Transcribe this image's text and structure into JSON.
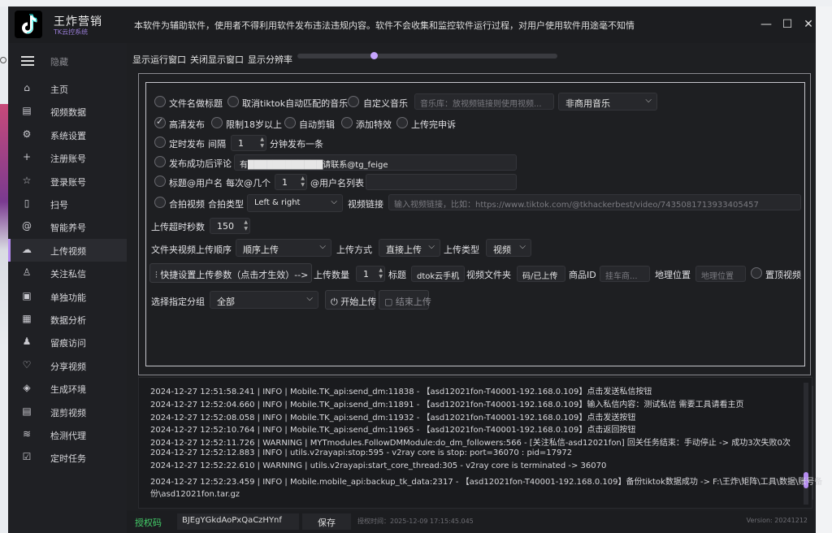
{
  "app": {
    "name": "王炸营销",
    "subtitle": "TK云控系统",
    "notice": "本软件为辅助软件，使用者不得利用软件发布违法违规内容。软件不会收集和监控软件运行过程，对用户使用软件用途毫不知情"
  },
  "window": {
    "minimize": "—",
    "maximize": "☐",
    "close": "✕"
  },
  "sidebar": {
    "hide_label": "隐藏",
    "items": [
      {
        "label": "主页",
        "icon": "home-icon",
        "glyph": "⌂"
      },
      {
        "label": "视频数据",
        "icon": "film-icon",
        "glyph": "▤"
      },
      {
        "label": "系统设置",
        "icon": "gear-icon",
        "glyph": "⚙"
      },
      {
        "label": "注册账号",
        "icon": "plus-icon",
        "glyph": "+"
      },
      {
        "label": "登录账号",
        "icon": "star-icon",
        "glyph": "☆"
      },
      {
        "label": "扫号",
        "icon": "phone-icon",
        "glyph": "▯"
      },
      {
        "label": "智能养号",
        "icon": "at-icon",
        "glyph": "@"
      },
      {
        "label": "上传视频",
        "icon": "cloud-upload-icon",
        "glyph": "☁"
      },
      {
        "label": "关注私信",
        "icon": "user-add-icon",
        "glyph": "♙"
      },
      {
        "label": "单独功能",
        "icon": "video-4k-icon",
        "glyph": "▣"
      },
      {
        "label": "数据分析",
        "icon": "calendar-icon",
        "glyph": "▦"
      },
      {
        "label": "留痕访问",
        "icon": "users-icon",
        "glyph": "♟"
      },
      {
        "label": "分享视频",
        "icon": "heart-icon",
        "glyph": "♡"
      },
      {
        "label": "生成环境",
        "icon": "layers-icon",
        "glyph": "◈"
      },
      {
        "label": "混剪视频",
        "icon": "film-strip-icon",
        "glyph": "▤"
      },
      {
        "label": "检测代理",
        "icon": "rss-icon",
        "glyph": "≋"
      },
      {
        "label": "定时任务",
        "icon": "checklist-icon",
        "glyph": "☑"
      }
    ]
  },
  "toolbar": {
    "show_window": "显示运行窗口",
    "hide_window": "关闭显示窗口",
    "show_resolution": "显示分辨率",
    "slider_value": 0.29
  },
  "form": {
    "filename_title": "文件名做标题",
    "cancel_music": "取消tiktok自动匹配的音乐",
    "custom_music": "自定义音乐",
    "music_lib_placeholder": "音乐库：放视频链接则使用视频...",
    "music_type": "非商用音乐",
    "hd_publish": "高清发布",
    "limit_18": "限制18岁以上",
    "auto_clip": "自动剪辑",
    "add_effects": "添加特效",
    "upload_appeal": "上传完申诉",
    "scheduled": "定时发布",
    "interval_label": "间隔",
    "interval_value": "1",
    "interval_unit": "分钟发布一条",
    "comment_after": "发布成功后评论",
    "comment_value": "有████████████请联系@tg_feige",
    "title_at_user": "标题@用户名",
    "every_at": "每次@几个",
    "at_count": "1",
    "user_list_label": "@用户名列表",
    "duet": "合拍视频",
    "duet_type_label": "合拍类型",
    "duet_type": "Left & right",
    "video_link_label": "视频链接",
    "video_link_placeholder": "输入视频链接，比如：https://www.tiktok.com/@tkhackerbest/video/7435081713933405457",
    "timeout_label": "上传超时秒数",
    "timeout_value": "150",
    "folder_order_label": "文件夹视频上传顺序",
    "folder_order": "顺序上传",
    "upload_mode_label": "上传方式",
    "upload_mode": "直接上传",
    "upload_type_label": "上传类型",
    "upload_type": "视频",
    "quick_setting": "快捷设置上传参数（点击才生效）-->",
    "upload_count_label": "上传数量",
    "upload_count": "1",
    "title_label": "标题",
    "title_value": "dtok云手机",
    "video_folder_label": "视频文件夹",
    "video_folder": "码/已上传",
    "product_id_label": "商品ID",
    "product_id_placeholder": "挂车商...",
    "location_label": "地理位置",
    "location_placeholder": "地理位置",
    "pin_video": "置顶视频",
    "group_label": "选择指定分组",
    "group_value": "全部",
    "start_upload": "开始上传",
    "stop_upload": "结束上传"
  },
  "log": [
    "2024-12-27 12:51:58.241 | INFO     | Mobile.TK_api:send_dm:11838 - 【asd12021fon-T40001-192.168.0.109】点击发送私信按钮",
    "2024-12-27 12:52:04.660 | INFO     | Mobile.TK_api:send_dm:11891 - 【asd12021fon-T40001-192.168.0.109】输入私信内容：测试私信 需要工具请看主页",
    "2024-12-27 12:52:08.058 | INFO     | Mobile.TK_api:send_dm:11932 - 【asd12021fon-T40001-192.168.0.109】点击发送按钮",
    "2024-12-27 12:52:10.764 | INFO     | Mobile.TK_api:send_dm:11965 - 【asd12021fon-T40001-192.168.0.109】点击返回按钮",
    "2024-12-27 12:52:11.726 | WARNING  | MYTmodules.FollowDMModule:do_dm_followers:566 - [关注私信-asd12021fon] 回关任务结束：手动停止 -> 成功3次失败0次",
    "2024-12-27 12:52:12.883 | INFO     | utils.v2rayapi:stop:595 - v2ray core is stop: port=36070 : pid=17972",
    "2024-12-27 12:52:22.610 | WARNING  | utils.v2rayapi:start_core_thread:305 - v2ray core is terminated -> 36070",
    "2024-12-27 12:52:23.459 | INFO     | Mobile.mobile_api:backup_tk_data:2317 - 【asd12021fon-T40001-192.168.0.109】备份tiktok数据成功 -> F:\\王炸\\矩阵\\工具\\数据\\账号备",
    "份\\asd12021fon.tar.gz"
  ],
  "footer": {
    "license_label": "授权码",
    "license_code": "BJEgYGkdAoPxQaCzHYnf",
    "save": "保存",
    "expires": "授权时间：2025-12-09 17:15:45.045",
    "version": "Version: 20241212"
  }
}
